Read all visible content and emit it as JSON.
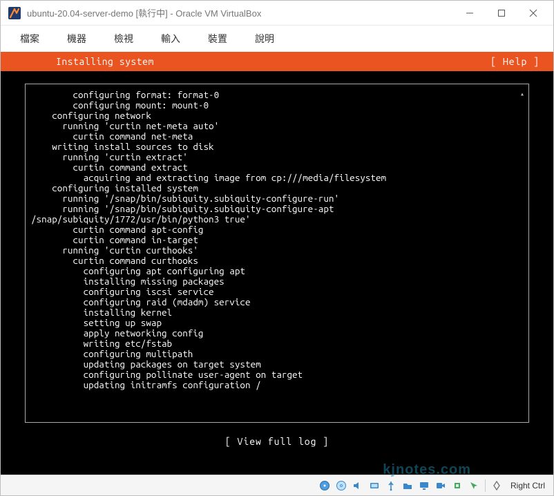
{
  "window": {
    "title": "ubuntu-20.04-server-demo [執行中] - Oracle VM VirtualBox"
  },
  "menubar": {
    "items": [
      "檔案",
      "機器",
      "檢視",
      "輸入",
      "裝置",
      "說明"
    ]
  },
  "installer": {
    "title": "Installing system",
    "help_label": "[ Help ]",
    "view_log_label": "[ View full log ]",
    "log_lines": [
      "        configuring format: format-0",
      "        configuring mount: mount-0",
      "    configuring network",
      "      running 'curtin net-meta auto'",
      "        curtin command net-meta",
      "    writing install sources to disk",
      "      running 'curtin extract'",
      "        curtin command extract",
      "          acquiring and extracting image from cp:///media/filesystem",
      "    configuring installed system",
      "      running '/snap/bin/subiquity.subiquity-configure-run'",
      "      running '/snap/bin/subiquity.subiquity-configure-apt",
      "/snap/subiquity/1772/usr/bin/python3 true'",
      "        curtin command apt-config",
      "        curtin command in-target",
      "      running 'curtin curthooks'",
      "        curtin command curthooks",
      "          configuring apt configuring apt",
      "          installing missing packages",
      "          configuring iscsi service",
      "          configuring raid (mdadm) service",
      "          installing kernel",
      "          setting up swap",
      "          apply networking config",
      "          writing etc/fstab",
      "          configuring multipath",
      "          updating packages on target system",
      "          configuring pollinate user-agent on target",
      "          updating initramfs configuration /"
    ]
  },
  "statusbar": {
    "right_ctrl": "Right Ctrl",
    "watermark": "kjnotes.com",
    "icons": [
      "hard-disk-icon",
      "optical-disc-icon",
      "audio-icon",
      "network-icon",
      "usb-icon",
      "shared-folder-icon",
      "display-icon",
      "recording-icon",
      "cpu-icon",
      "mouse-integration-icon"
    ]
  }
}
